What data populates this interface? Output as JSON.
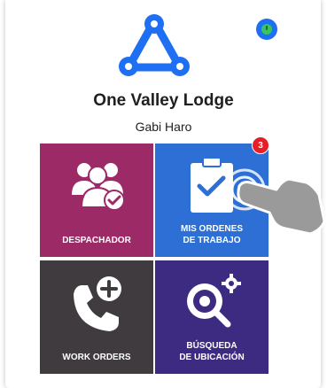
{
  "app": {
    "title": "One Valley Lodge",
    "user_name": "Gabi Haro",
    "logo_icon": "triangle-nodes-logo-icon",
    "status_icon": "clock-status-icon"
  },
  "colors": {
    "brand_blue": "#1f6ff2",
    "tile_dispatcher": "#9b2a66",
    "tile_work_orders_mine": "#2d6fd4",
    "tile_work_orders": "#3f3b3e",
    "tile_location_search": "#3d2b82",
    "badge": "#e81e25"
  },
  "tiles": [
    {
      "label": "DESPACHADOR",
      "icon": "users-check-icon"
    },
    {
      "label_line1": "MIS ORDENES",
      "label_line2": "DE TRABAJO",
      "icon": "clipboard-check-icon",
      "badge_count": "3"
    },
    {
      "label": "WORK ORDERS",
      "icon": "phone-plus-icon"
    },
    {
      "label_line1": "BÚSQUEDA",
      "label_line2": "DE UBICACIÓN",
      "icon": "gear-search-icon"
    }
  ],
  "overlay": {
    "icon": "tap-hand-icon"
  }
}
